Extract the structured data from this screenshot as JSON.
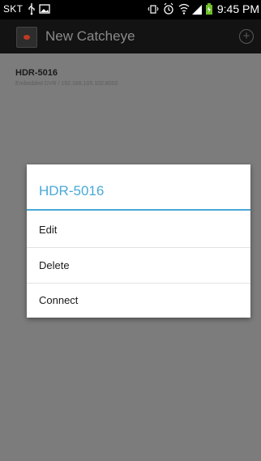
{
  "status_bar": {
    "carrier": "SKT",
    "time": "9:45 PM",
    "icons": [
      "usb-icon",
      "image-icon",
      "vibrate-icon",
      "alarm-icon",
      "wifi-icon",
      "signal-icon",
      "battery-icon"
    ]
  },
  "header": {
    "title": "New Catcheye",
    "logo_icon": "camera-logo-icon",
    "add_icon": "add-circle-icon"
  },
  "devices": [
    {
      "name": "HDR-5016",
      "description": "Embedded DVR / 192.168.105.102:8000"
    }
  ],
  "dialog": {
    "title": "HDR-5016",
    "items": [
      {
        "label": "Edit"
      },
      {
        "label": "Delete"
      },
      {
        "label": "Connect"
      }
    ]
  },
  "colors": {
    "accent": "#4aa8d8",
    "background_dim": "#7c7c7c",
    "header_bg": "#131313"
  }
}
